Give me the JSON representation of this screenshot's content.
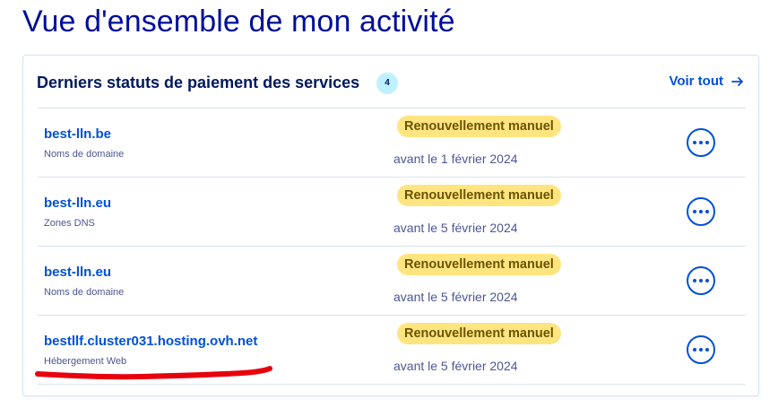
{
  "page": {
    "title": "Vue d'ensemble de mon activité"
  },
  "card": {
    "title": "Derniers statuts de paiement des services",
    "count": "4",
    "see_all_label": "Voir tout",
    "see_all_icon": "arrow-right-icon"
  },
  "services": [
    {
      "name": "best-lln.be",
      "type": "Noms de domaine",
      "status": "Renouvellement manuel",
      "date": "avant le 1 février 2024",
      "action_icon": "more-options-icon"
    },
    {
      "name": "best-lln.eu",
      "type": "Zones DNS",
      "status": "Renouvellement manuel",
      "date": "avant le 5 février 2024",
      "action_icon": "more-options-icon"
    },
    {
      "name": "best-lln.eu",
      "type": "Noms de domaine",
      "status": "Renouvellement manuel",
      "date": "avant le 5 février 2024",
      "action_icon": "more-options-icon"
    },
    {
      "name": "bestllf.cluster031.hosting.ovh.net",
      "type": "Hébergement Web",
      "status": "Renouvellement manuel",
      "date": "avant le 5 février 2024",
      "action_icon": "more-options-icon"
    }
  ],
  "colors": {
    "title": "#000e9c",
    "link": "#0050d7",
    "badge_bg": "#ffe580",
    "count_badge_bg": "#bef1ff",
    "annotation": "#e8000d"
  }
}
